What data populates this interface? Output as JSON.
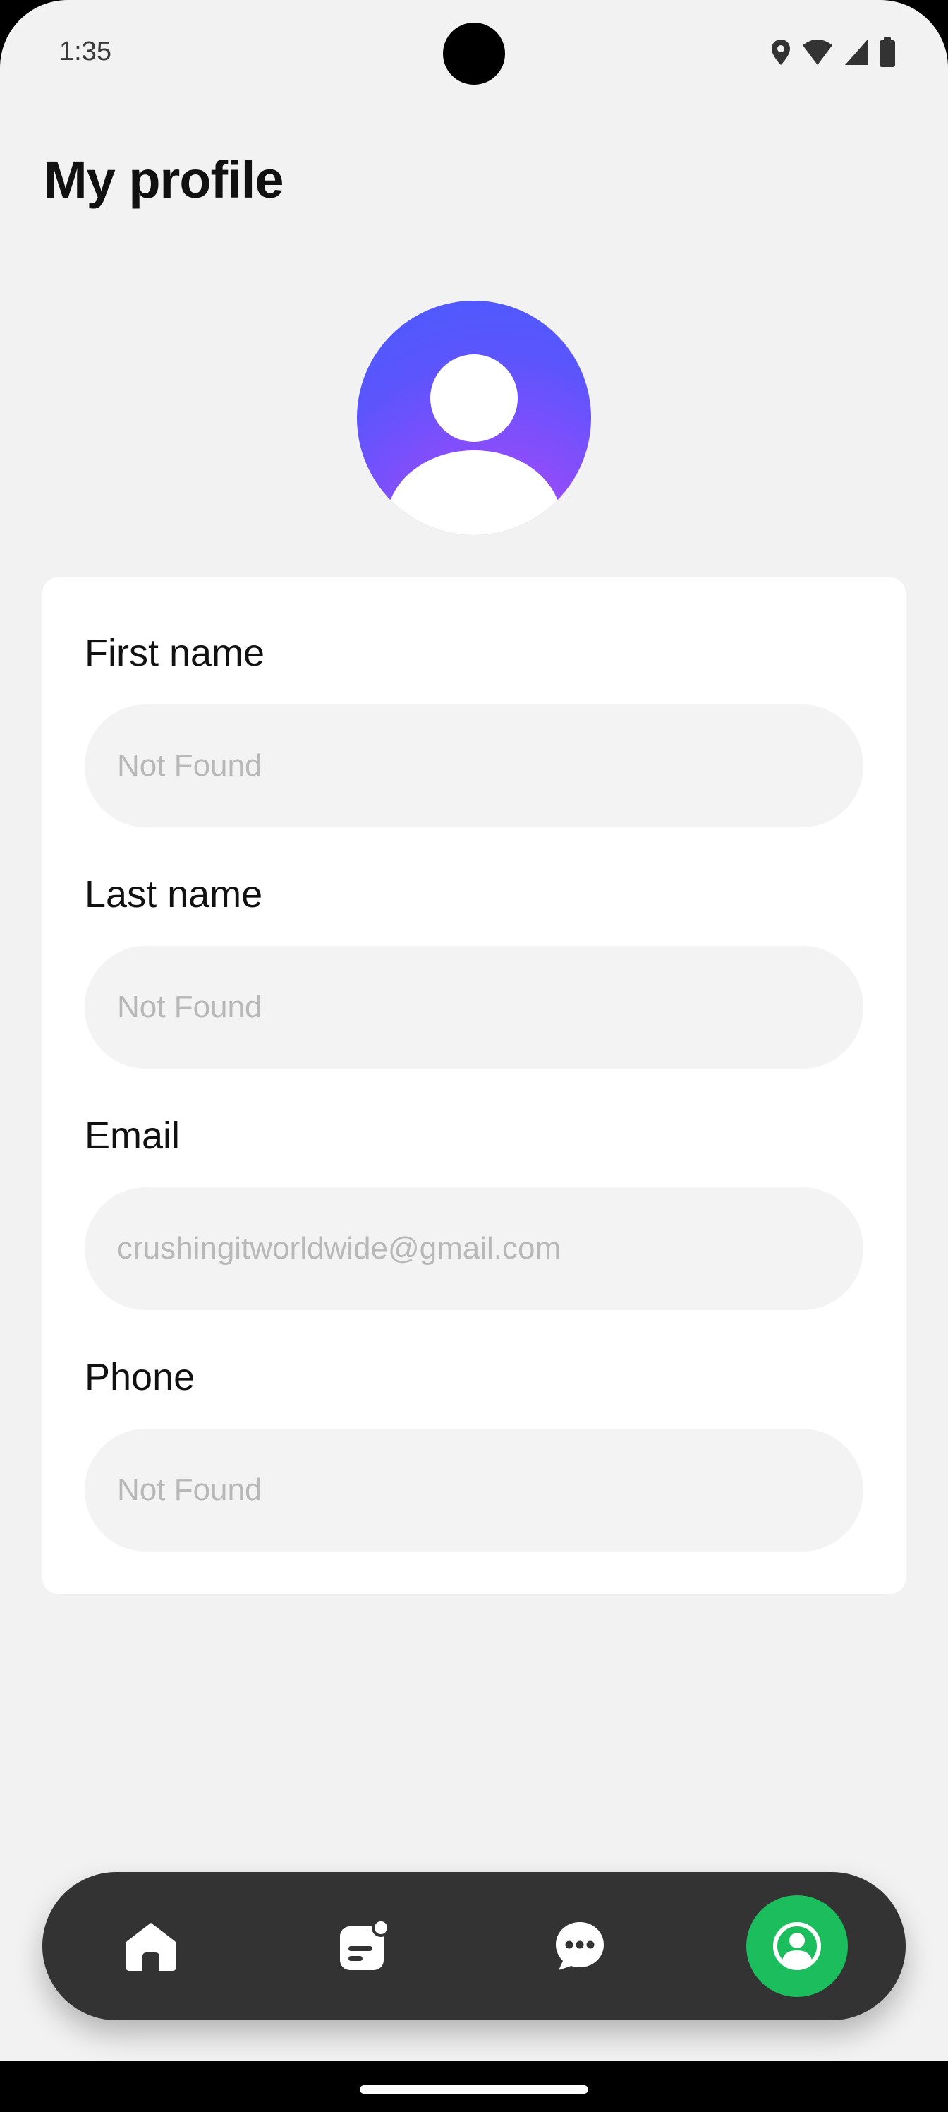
{
  "status_bar": {
    "time": "1:35",
    "icons": [
      "location-icon",
      "wifi-icon",
      "signal-icon",
      "battery-icon"
    ]
  },
  "page": {
    "title": "My profile"
  },
  "avatar": {
    "icon": "user-avatar-icon",
    "gradient_colors": [
      "#4a5cff",
      "#c84cf3"
    ]
  },
  "form": {
    "fields": [
      {
        "label": "First name",
        "value": "Not Found"
      },
      {
        "label": "Last name",
        "value": "Not Found"
      },
      {
        "label": "Email",
        "value": "crushingitworldwide@gmail.com"
      },
      {
        "label": "Phone",
        "value": "Not Found"
      }
    ]
  },
  "bottom_nav": {
    "items": [
      {
        "name": "home",
        "icon": "home-icon",
        "active": false
      },
      {
        "name": "notes",
        "icon": "notes-icon",
        "active": false
      },
      {
        "name": "chat",
        "icon": "chat-icon",
        "active": false
      },
      {
        "name": "profile",
        "icon": "profile-icon",
        "active": true
      }
    ],
    "background": "#333333",
    "active_color": "#1bbd5c"
  },
  "colors": {
    "screen_background": "#f2f2f2",
    "card_background": "#ffffff",
    "input_background": "#f3f3f3",
    "input_text": "#b8b8b8"
  }
}
